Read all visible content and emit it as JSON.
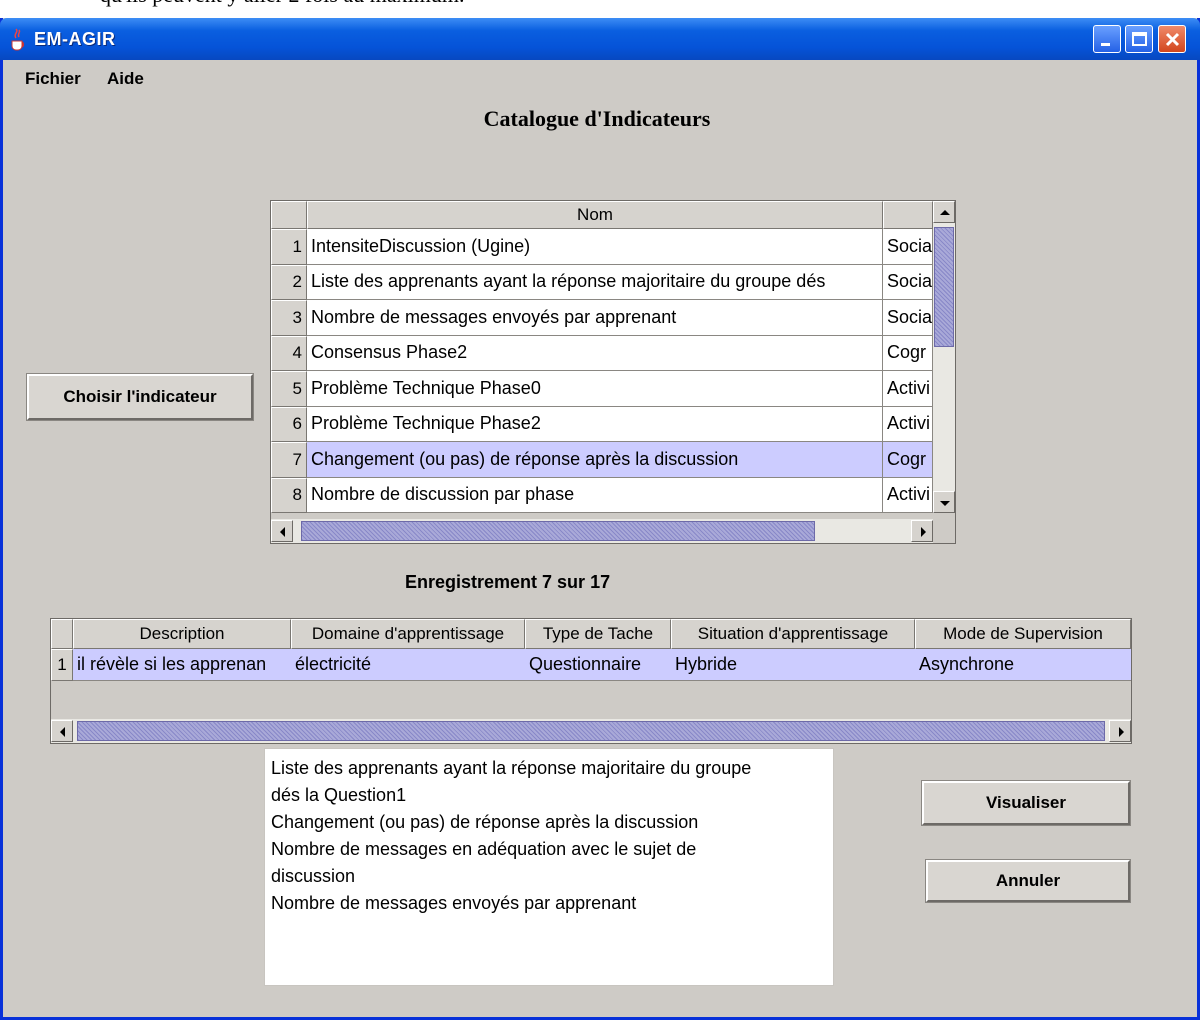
{
  "background_text": "qu'ils peuvent y aller 2 fois au maximum.",
  "window": {
    "title": "EM-AGIR",
    "controls": {
      "minimize_icon": "minimize-icon",
      "maximize_icon": "maximize-icon",
      "close_icon": "close-icon"
    }
  },
  "menu": {
    "file": "Fichier",
    "help": "Aide"
  },
  "catalogue_title": "Catalogue d'Indicateurs",
  "choose_button": "Choisir l'indicateur",
  "indicators": {
    "headers": [
      "Nom",
      ""
    ],
    "rows": [
      {
        "num": "1",
        "name": "IntensiteDiscussion (Ugine)",
        "type": "Socia"
      },
      {
        "num": "2",
        "name": "Liste des apprenants ayant la réponse majoritaire du groupe dés",
        "type": "Socia"
      },
      {
        "num": "3",
        "name": "Nombre de messages envoyés par apprenant",
        "type": "Socia"
      },
      {
        "num": "4",
        "name": "Consensus Phase2",
        "type": "Cogr"
      },
      {
        "num": "5",
        "name": "Problème Technique Phase0",
        "type": "Activi"
      },
      {
        "num": "6",
        "name": "Problème Technique Phase2",
        "type": "Activi"
      },
      {
        "num": "7",
        "name": "Changement (ou pas) de réponse après la discussion",
        "type": "Cogr"
      },
      {
        "num": "8",
        "name": "Nombre de discussion par phase",
        "type": "Activi"
      }
    ],
    "selected_row": 7
  },
  "record_label": "Enregistrement 7 sur 17",
  "details": {
    "headers": [
      "Description",
      "Domaine d'apprentissage",
      "Type de Tache",
      "Situation d'apprentissage",
      "Mode de Supervision"
    ],
    "row": {
      "num": "1",
      "cells": [
        "il révèle si les apprenan",
        "électricité",
        "Questionnaire",
        "Hybride",
        "Asynchrone"
      ]
    }
  },
  "selected_list": [
    "Liste des apprenants ayant la réponse majoritaire du groupe",
    "dés la Question1",
    "Changement (ou pas) de réponse après la discussion",
    "Nombre de messages en adéquation avec le sujet de",
    "discussion",
    "Nombre de messages envoyés par apprenant"
  ],
  "buttons": {
    "visualize": "Visualiser",
    "cancel": "Annuler"
  },
  "colors": {
    "title_bar": "#0553d8",
    "selection": "#ccccff",
    "window_bg": "#cecbc6",
    "scroll_thumb": "#a9a9d8"
  }
}
